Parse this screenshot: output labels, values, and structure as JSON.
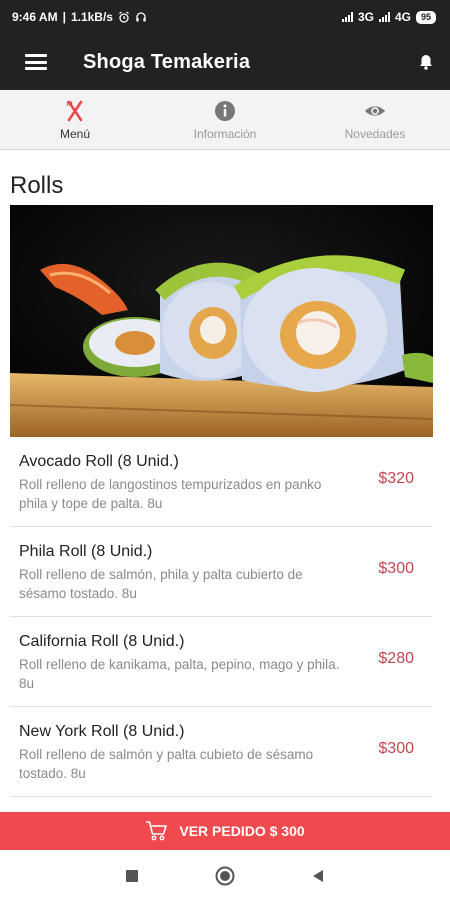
{
  "status": {
    "time": "9:46 AM",
    "speed": "1.1kB/s",
    "net1": "3G",
    "net2": "4G",
    "battery": "95"
  },
  "app": {
    "title": "Shoga Temakeria"
  },
  "tabs": [
    {
      "label": "Menú",
      "icon": "fork-knife-icon"
    },
    {
      "label": "Información",
      "icon": "info-icon"
    },
    {
      "label": "Novedades",
      "icon": "eye-icon"
    }
  ],
  "section": {
    "title": "Rolls"
  },
  "items": [
    {
      "name": "Avocado Roll (8 Unid.)",
      "desc": "Roll relleno de langostinos tempurizados en panko phila y tope de palta. 8u",
      "price": "$320"
    },
    {
      "name": "Phila Roll (8 Unid.)",
      "desc": "Roll relleno de salmón, phila y palta cubierto de sésamo tostado. 8u",
      "price": "$300"
    },
    {
      "name": "California Roll (8 Unid.)",
      "desc": "Roll relleno de kanikama, palta, pepino, mago y phila. 8u",
      "price": "$280"
    },
    {
      "name": "New York Roll (8 Unid.)",
      "desc": "Roll relleno de salmón y palta cubieto de sésamo tostado. 8u",
      "price": "$300"
    }
  ],
  "order": {
    "label": "VER PEDIDO $ 300"
  },
  "colors": {
    "accent": "#f04a4e",
    "price": "#c6464f",
    "appbar": "#222222"
  }
}
